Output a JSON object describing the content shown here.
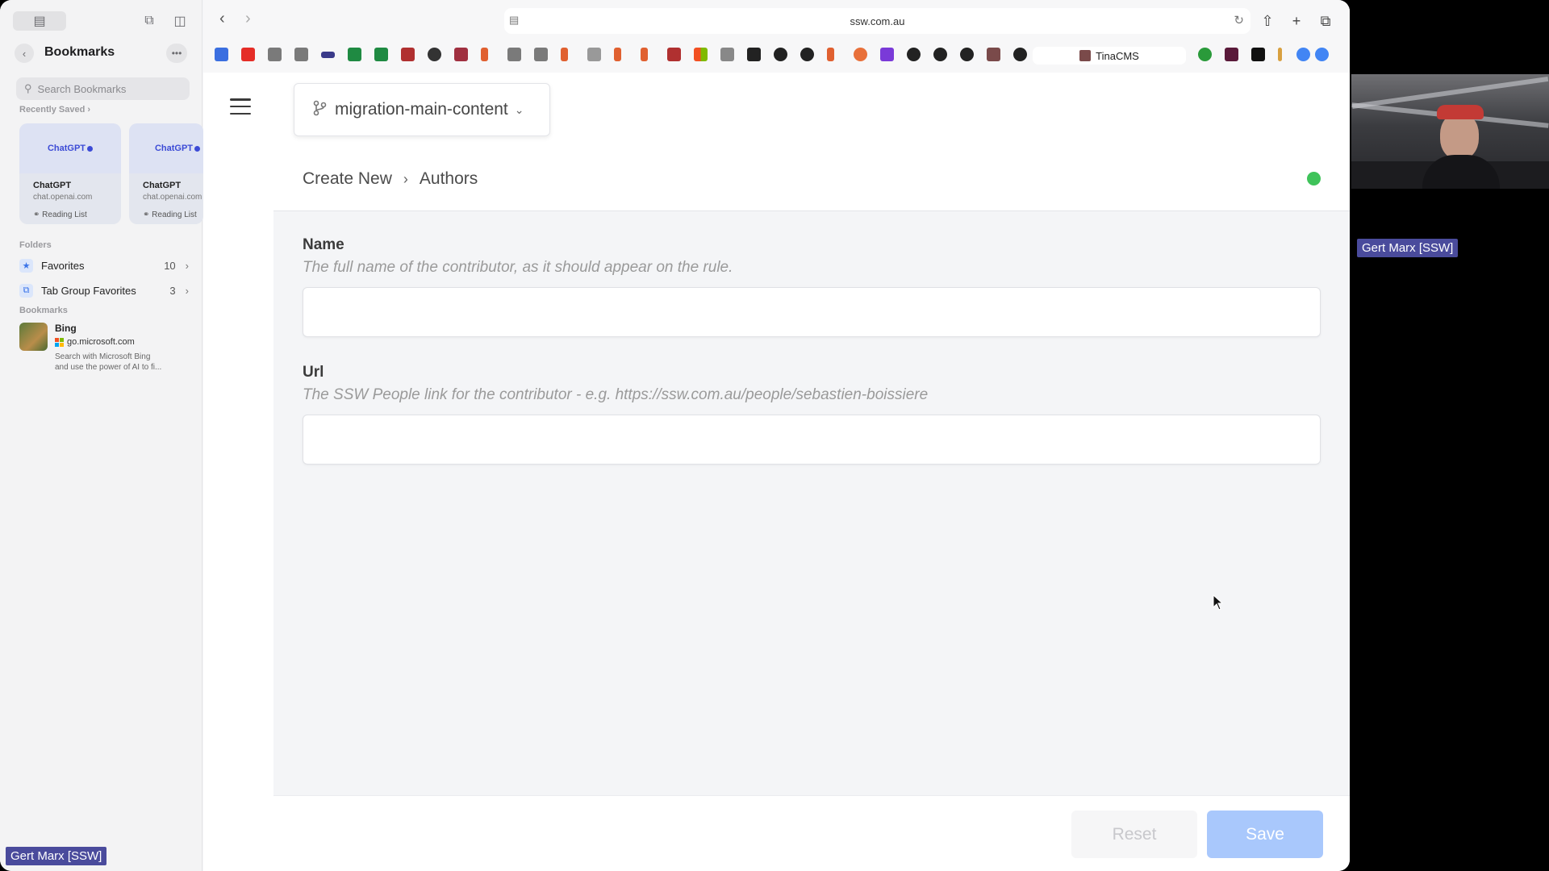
{
  "sidebar": {
    "title": "Bookmarks",
    "search_placeholder": "Search Bookmarks",
    "recently_saved_label": "Recently Saved",
    "recent_cards": [
      {
        "thumb": "ChatGPT",
        "title": "ChatGPT",
        "url": "chat.openai.com",
        "list": "Reading List"
      },
      {
        "thumb": "ChatGPT",
        "title": "ChatGPT",
        "url": "chat.openai.com",
        "list": "Reading List"
      }
    ],
    "folders_label": "Folders",
    "folders": [
      {
        "label": "Favorites",
        "count": "10"
      },
      {
        "label": "Tab Group Favorites",
        "count": "3"
      }
    ],
    "bookmarks_label": "Bookmarks",
    "bookmarks": [
      {
        "title": "Bing",
        "url": "go.microsoft.com",
        "desc1": "Search with Microsoft Bing",
        "desc2": "and use the power of AI to fi..."
      }
    ]
  },
  "toolbar": {
    "url": "ssw.com.au",
    "pinned_tab": "TinaCMS"
  },
  "app": {
    "branch": "migration-main-content",
    "breadcrumb": {
      "parent": "Create New",
      "current": "Authors"
    },
    "status_color": "#3fc35a",
    "fields": [
      {
        "label": "Name",
        "description": "The full name of the contributor, as it should appear on the rule.",
        "value": ""
      },
      {
        "label": "Url",
        "description": "The SSW People link for the contributor - e.g. https://ssw.com.au/people/sebastien-boissiere",
        "value": ""
      }
    ],
    "reset_label": "Reset",
    "save_label": "Save"
  },
  "participant": {
    "name_video": "Gert Marx [SSW]",
    "name_bottom": "Gert Marx [SSW]"
  },
  "colors": {
    "accent_disabled": "#a9c8fc",
    "badge": "#4a4b9c"
  }
}
